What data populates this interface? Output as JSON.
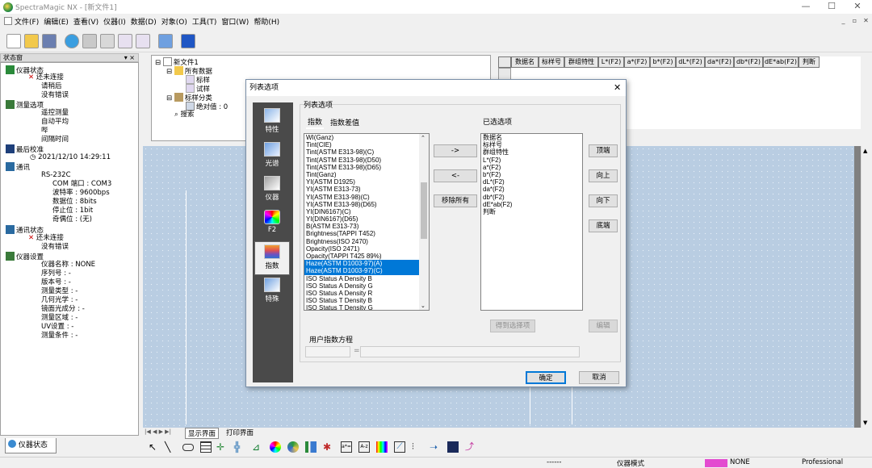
{
  "window": {
    "title": "SpectraMagic NX - [新文件1]"
  },
  "menu": [
    "文件(F)",
    "编辑(E)",
    "查看(V)",
    "仪器(I)",
    "数据(D)",
    "对象(O)",
    "工具(T)",
    "窗口(W)",
    "帮助(H)"
  ],
  "status_panel": {
    "header": "状态窗",
    "tab_label": "仪器状态",
    "rows": [
      "仪器状态",
      "还未连接",
      "请稍后",
      "没有错误",
      "测量选项",
      "遥控测量",
      "自动平均",
      "哔",
      "间隔时间",
      "最后校准",
      "2021/12/10 14:29:11",
      "通讯",
      "RS-232C",
      "COM 端口 : COM3",
      "波特率 : 9600bps",
      "数据位 : 8bits",
      "停止位 : 1bit",
      "奇偶位 : (无)",
      "通讯状态",
      "还未连接",
      "没有错误",
      "仪器设置",
      "仪器名称 : NONE",
      "序列号 : -",
      "版本号 : -",
      "测量类型 : -",
      "几何光学 : -",
      "镜面光成分 : -",
      "测量区域 : -",
      "UV设置 : -",
      "测量条件 : -"
    ]
  },
  "file_tree": [
    "新文件1",
    "所有数据",
    "标样",
    "试样",
    "标样分类",
    "绝对值 : 0",
    "搜索"
  ],
  "table_headers": [
    "数据名",
    "标样号",
    "群组特性",
    "L*(F2)",
    "a*(F2)",
    "b*(F2)",
    "dL*(F2)",
    "da*(F2)",
    "db*(F2)",
    "dE*ab(F2)",
    "判断"
  ],
  "view_tabs": [
    "显示界面",
    "打印界面"
  ],
  "dialog": {
    "title": "列表选项",
    "close": "✕",
    "categories": [
      "特性",
      "光谱",
      "仪器",
      "F2",
      "指数",
      "特殊"
    ],
    "selected_category": "指数",
    "group_label": "列表选项",
    "tabs": [
      "指数",
      "指数差值"
    ],
    "available_items": [
      "WI(Ganz)",
      "Tint(CIE)",
      "Tint(ASTM E313-98)(C)",
      "Tint(ASTM E313-98)(D50)",
      "Tint(ASTM E313-98)(D65)",
      "Tint(Ganz)",
      "YI(ASTM D1925)",
      "YI(ASTM E313-73)",
      "YI(ASTM E313-98)(C)",
      "YI(ASTM E313-98)(D65)",
      "YI(DIN6167)(C)",
      "YI(DIN6167)(D65)",
      "B(ASTM E313-73)",
      "Brightness(TAPPI T452)",
      "Brightness(ISO 2470)",
      "Opacity(ISO 2471)",
      "Opacity(TAPPI T425 89%)",
      "Haze(ASTM D1003-97)(A)",
      "Haze(ASTM D1003-97)(C)",
      "ISO Status A Density B",
      "ISO Status A Density G",
      "ISO Status A Density R",
      "ISO Status T Density B",
      "ISO Status T Density G"
    ],
    "highlighted": [
      "Haze(ASTM D1003-97)(A)",
      "Haze(ASTM D1003-97)(C)"
    ],
    "selected_label": "已选选项",
    "selected_items": [
      "数据名",
      "标样号",
      "群组特性",
      "L*(F2)",
      "a*(F2)",
      "b*(F2)",
      "dL*(F2)",
      "da*(F2)",
      "db*(F2)",
      "dE*ab(F2)",
      "判断"
    ],
    "add_btn": "->",
    "remove_btn": "<-",
    "remove_all_btn": "移除所有",
    "top_btn": "顶端",
    "up_btn": "向上",
    "down_btn": "向下",
    "bottom_btn": "底端",
    "get_btn": "得到选择项",
    "edit_btn": "编辑",
    "user_eq_label": "用户指数方程",
    "eq_sign": "=",
    "ok_btn": "确定",
    "cancel_btn": "取消"
  },
  "statusbar": {
    "dashes": "------",
    "mode": "仪器模式",
    "device": "NONE",
    "level": "Professional"
  },
  "colors": {
    "canvas": "#b9cde2",
    "selection": "#0078d7",
    "category_bg": "#4a4a4a"
  }
}
